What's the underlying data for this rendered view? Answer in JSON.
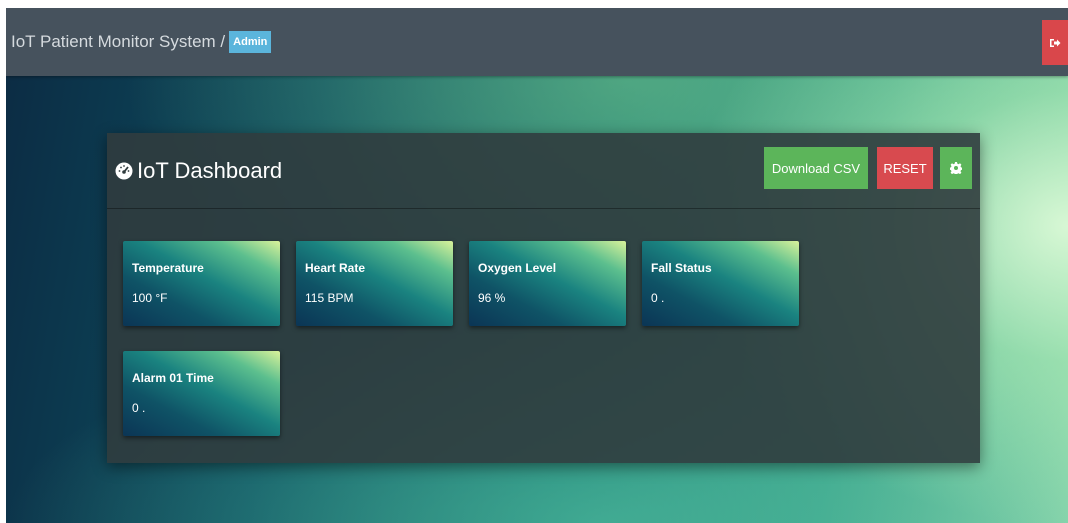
{
  "navbar": {
    "title": "IoT Patient Monitor System /",
    "user_badge": "Admin",
    "logout_icon": "sign-out-icon",
    "logout_color": "#d9474b"
  },
  "dashboard": {
    "title": "IoT Dashboard",
    "title_icon": "dashboard-gauge-icon",
    "buttons": {
      "download_csv": "Download CSV",
      "reset": "RESET",
      "settings_icon": "gear-icon"
    }
  },
  "cards": [
    {
      "label": "Temperature",
      "value": "100 °F"
    },
    {
      "label": "Heart Rate",
      "value": "115 BPM"
    },
    {
      "label": "Oxygen Level",
      "value": "96 %"
    },
    {
      "label": "Fall Status",
      "value": "0 ."
    },
    {
      "label": "Alarm 01 Time",
      "value": "0 ."
    }
  ],
  "colors": {
    "navbar": "#46525d",
    "admin_badge": "#5bb5dc",
    "success": "#5cb55a",
    "danger": "#d84a4f"
  }
}
